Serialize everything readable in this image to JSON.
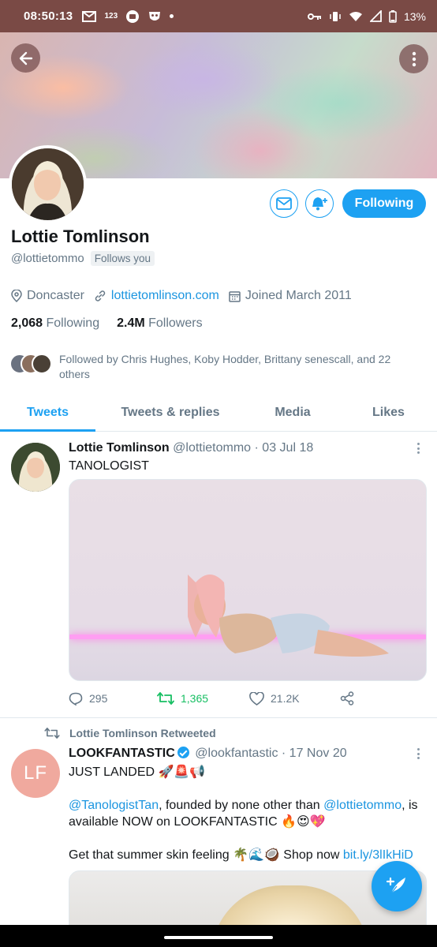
{
  "status_bar": {
    "time": "08:50:13",
    "mini_label": "123",
    "battery": "13%"
  },
  "profile": {
    "name": "Lottie Tomlinson",
    "handle": "@lottietommo",
    "follows_you": "Follows you",
    "location": "Doncaster",
    "website": "lottietomlinson.com",
    "joined": "Joined March 2011",
    "following_count": "2,068",
    "following_label": "Following",
    "followers_count": "2.4M",
    "followers_label": "Followers",
    "followed_by": "Followed by Chris Hughes, Koby Hodder, Brittany senescall, and 22 others",
    "following_button": "Following"
  },
  "tabs": [
    {
      "label": "Tweets",
      "active": true
    },
    {
      "label": "Tweets & replies",
      "active": false
    },
    {
      "label": "Media",
      "active": false
    },
    {
      "label": "Likes",
      "active": false
    }
  ],
  "tweets": [
    {
      "author": "Lottie Tomlinson",
      "handle": "@lottietommo",
      "date": "· 03 Jul 18",
      "text": "TANOLOGIST",
      "replies": "295",
      "retweets": "1,365",
      "likes": "21.2K"
    },
    {
      "retweeted_by": "Lottie Tomlinson Retweeted",
      "avatar_initials": "LF",
      "author": "LOOKFANTASTIC",
      "handle": "@lookfantastic",
      "date": "· 17 Nov 20",
      "line1": "JUST LANDED 🚀🚨📢",
      "mention1": "@TanologistTan",
      "middle": ", founded by none other than ",
      "mention2": "@lottietommo",
      "line2_end": ", is available NOW on LOOKFANTASTIC 🔥😍💖",
      "line3": "Get that summer skin feeling 🌴🌊🥥 Shop now ",
      "short_link": "bit.ly/3lIkHiD"
    }
  ],
  "colors": {
    "accent": "#1da1f2",
    "retweet": "#17bf63",
    "status_bar": "#7a4a45"
  }
}
